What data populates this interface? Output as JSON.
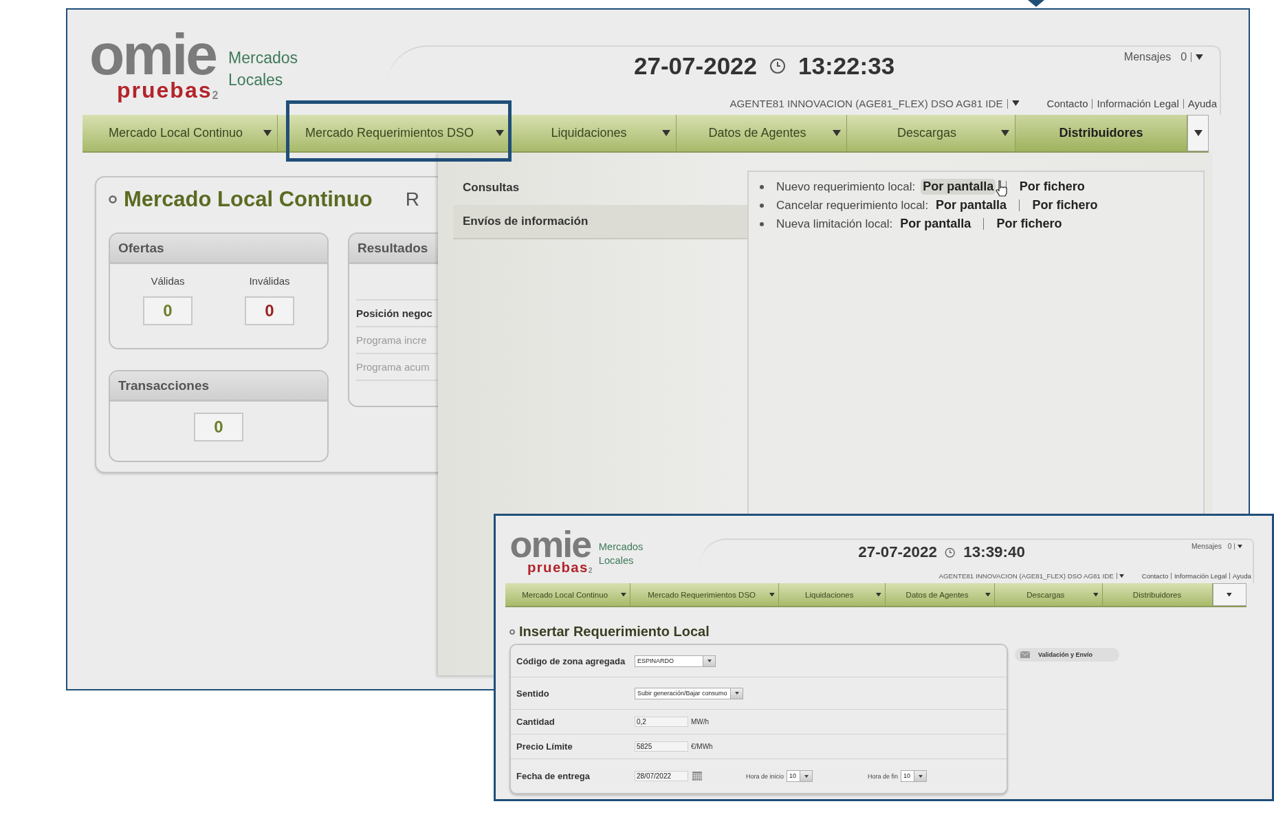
{
  "main_screen": {
    "header": {
      "logo": "omie",
      "logo_badge": "pruebas",
      "logo_badge_sub": "2",
      "product": "Mercados Locales",
      "date": "27-07-2022",
      "time": "13:22:33",
      "messages_label": "Mensajes",
      "messages_count": "0",
      "agent": "AGENTE81 INNOVACION (AGE81_FLEX) DSO AG81 IDE",
      "links": [
        "Contacto",
        "Información Legal",
        "Ayuda"
      ]
    },
    "nav": [
      {
        "label": "Mercado Local Continuo",
        "selected": false
      },
      {
        "label": "Mercado Requerimientos DSO",
        "selected": false
      },
      {
        "label": "Liquidaciones",
        "selected": false
      },
      {
        "label": "Datos de Agentes",
        "selected": false
      },
      {
        "label": "Descargas",
        "selected": false
      },
      {
        "label": "Distribuidores",
        "selected": true
      }
    ],
    "panel": {
      "title": "Mercado Local Continuo",
      "title_next": "R",
      "offers": {
        "title": "Ofertas",
        "valid_label": "Válidas",
        "valid": "0",
        "invalid_label": "Inválidas",
        "invalid": "0"
      },
      "transactions": {
        "title": "Transacciones",
        "value": "0"
      },
      "results": {
        "title": "Resultados",
        "rows": [
          {
            "label": "Posición negoc",
            "kind": "bold"
          },
          {
            "label": "Programa incre",
            "kind": "muted"
          },
          {
            "label": "Programa acum",
            "kind": "muted"
          }
        ]
      }
    },
    "dropdown": {
      "sections": [
        {
          "label": "Consultas",
          "selected": false
        },
        {
          "label": "Envíos de información",
          "selected": true
        }
      ],
      "items": [
        {
          "label": "Nuevo requerimiento local:",
          "links": [
            {
              "label": "Por pantalla",
              "hovered": true
            },
            {
              "label": "Por fichero",
              "hovered": false
            }
          ]
        },
        {
          "label": "Cancelar requerimiento local:",
          "links": [
            {
              "label": "Por pantalla",
              "hovered": false
            },
            {
              "label": "Por fichero",
              "hovered": false
            }
          ]
        },
        {
          "label": "Nueva limitación local:",
          "links": [
            {
              "label": "Por pantalla",
              "hovered": false
            },
            {
              "label": "Por fichero",
              "hovered": false
            }
          ]
        }
      ]
    }
  },
  "inset_screen": {
    "header": {
      "logo": "omie",
      "logo_badge": "pruebas",
      "logo_badge_sub": "2",
      "product": "Mercados Locales",
      "date": "27-07-2022",
      "time": "13:39:40",
      "messages_label": "Mensajes",
      "messages_count": "0",
      "agent": "AGENTE81 INNOVACION (AGE81_FLEX) DSO AG81 IDE",
      "links": [
        "Contacto",
        "Información Legal",
        "Ayuda"
      ]
    },
    "nav": [
      {
        "label": "Mercado Local Continuo",
        "selected": false
      },
      {
        "label": "Mercado Requerimientos DSO",
        "selected": false
      },
      {
        "label": "Liquidaciones",
        "selected": false
      },
      {
        "label": "Datos de Agentes",
        "selected": false
      },
      {
        "label": "Descargas",
        "selected": false
      },
      {
        "label": "Distribuidores",
        "selected": false
      }
    ],
    "title": "Insertar Requerimiento Local",
    "form": [
      {
        "kind": "select",
        "label": "Código de zona agregada",
        "value": "ESPINARDO"
      },
      {
        "kind": "select",
        "label": "Sentido",
        "value": "Subir generación/Bajar consumo"
      },
      {
        "kind": "input",
        "label": "Cantidad",
        "value": "0,2",
        "unit": "MW/h"
      },
      {
        "kind": "input",
        "label": "Precio Límite",
        "value": "5825",
        "unit": "€/MWh"
      },
      {
        "kind": "date",
        "label": "Fecha de entrega",
        "value": "28/07/2022",
        "start_label": "Hora de inicio",
        "start": "10",
        "end_label": "Hora de fin",
        "end": "10"
      }
    ],
    "submit": "Validación y Envío"
  }
}
